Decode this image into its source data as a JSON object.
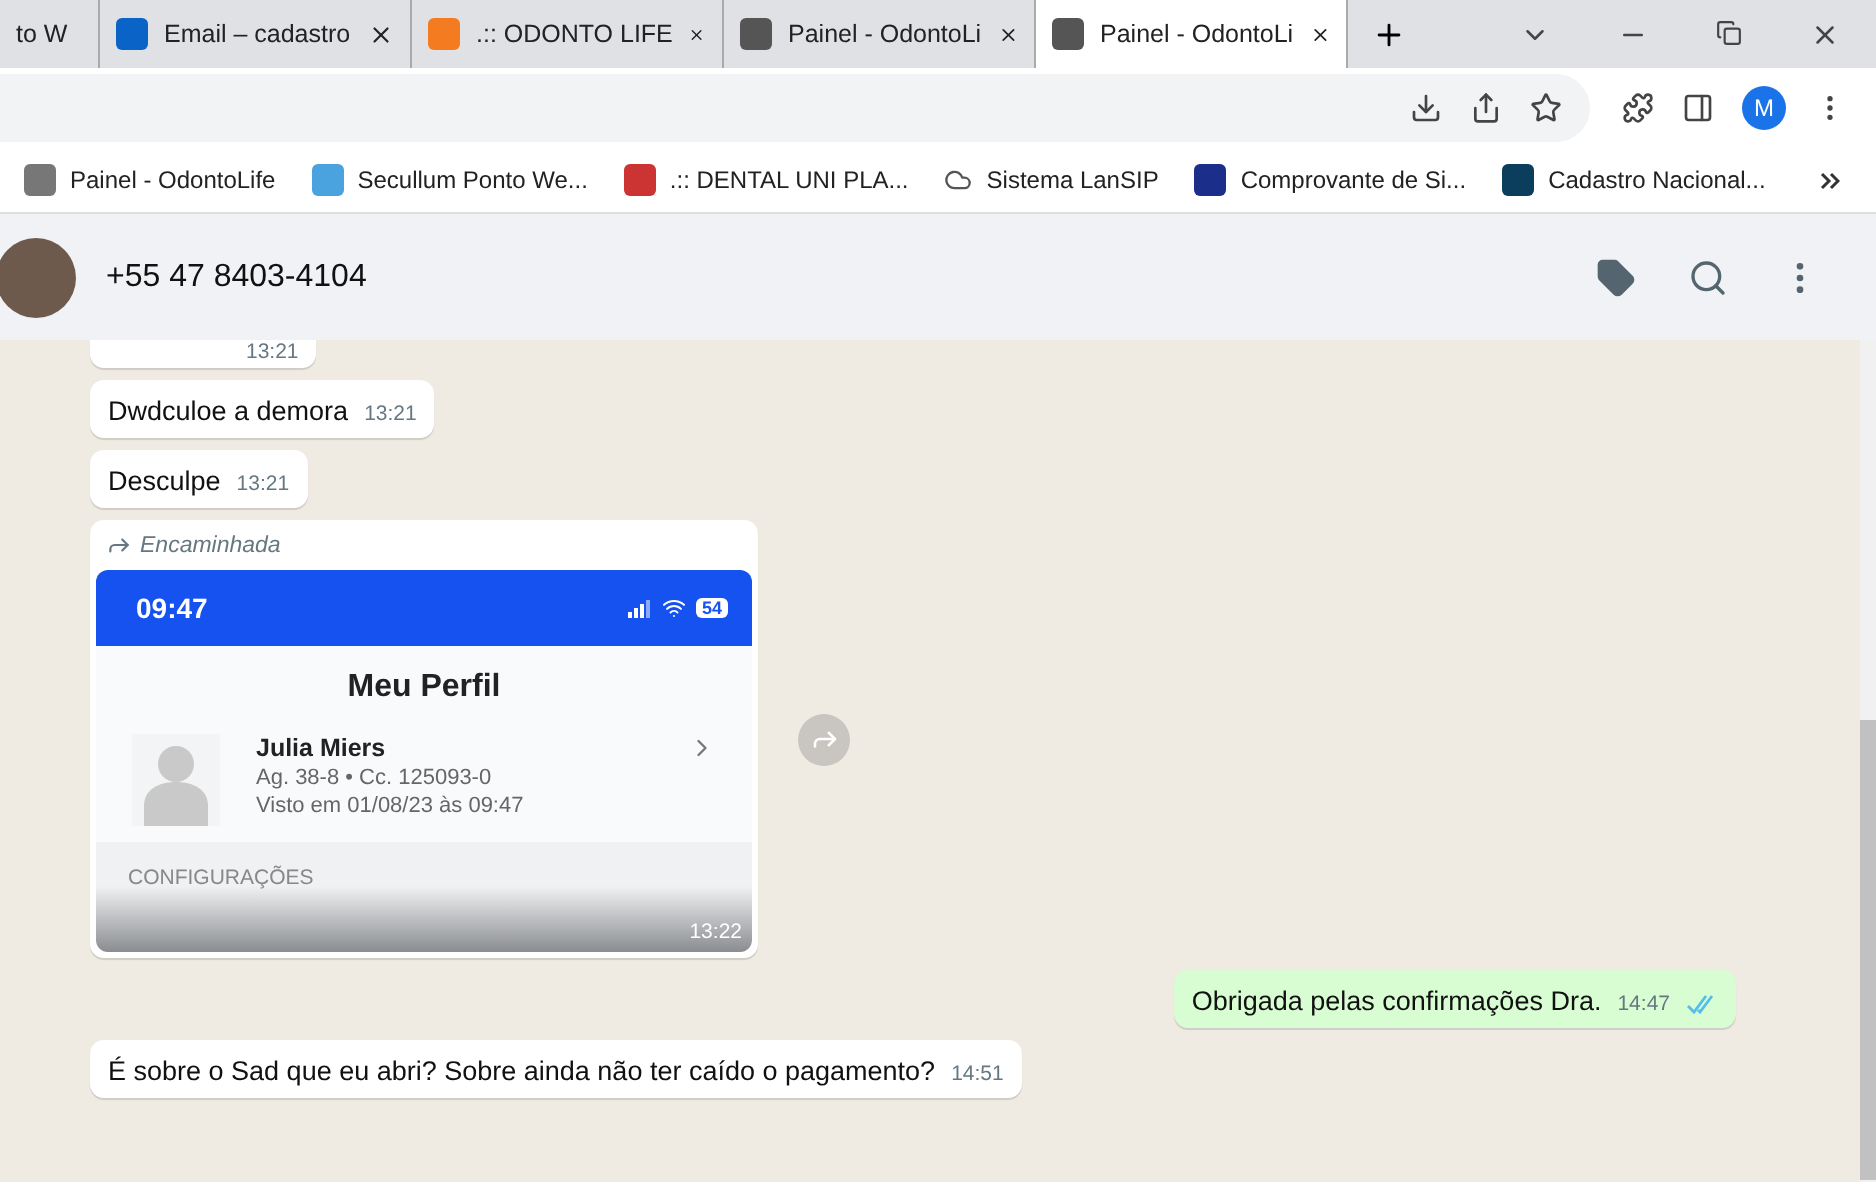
{
  "browser": {
    "tabs": [
      {
        "title": "to W",
        "selected": false
      },
      {
        "title": "Email – cadastro",
        "selected": false
      },
      {
        "title": ".:: ODONTO LIFE",
        "selected": false
      },
      {
        "title": "Painel - OdontoLi",
        "selected": false
      },
      {
        "title": "Painel - OdontoLi",
        "selected": true
      }
    ],
    "profile": "M",
    "bookmarks": [
      "Painel - OdontoLife",
      "Secullum Ponto We...",
      ".:: DENTAL UNI PLA...",
      "Sistema LanSIP",
      "Comprovante de Si...",
      "Cadastro Nacional..."
    ]
  },
  "chat": {
    "contact": "+55 47 8403-4104",
    "messages": [
      {
        "kind": "cut",
        "time": "13:21"
      },
      {
        "kind": "incoming",
        "text": "Dwdculoe a demora",
        "time": "13:21"
      },
      {
        "kind": "incoming",
        "text": "Desculpe",
        "time": "13:21"
      },
      {
        "kind": "forwarded_image",
        "label": "Encaminhada",
        "time": "13:22",
        "screen": {
          "clock": "09:47",
          "battery": "54",
          "title": "Meu Perfil",
          "name": "Julia Miers",
          "account": "Ag. 38-8 • Cc. 125093-0",
          "seen": "Visto em 01/08/23 às 09:47",
          "section": "CONFIGURAÇÕES"
        }
      },
      {
        "kind": "outgoing",
        "text": "Obrigada pelas confirmações Dra.",
        "time": "14:47",
        "read": true
      },
      {
        "kind": "incoming",
        "text": "É sobre o Sad que eu abri? Sobre ainda não ter caído o pagamento?",
        "time": "14:51"
      }
    ]
  }
}
